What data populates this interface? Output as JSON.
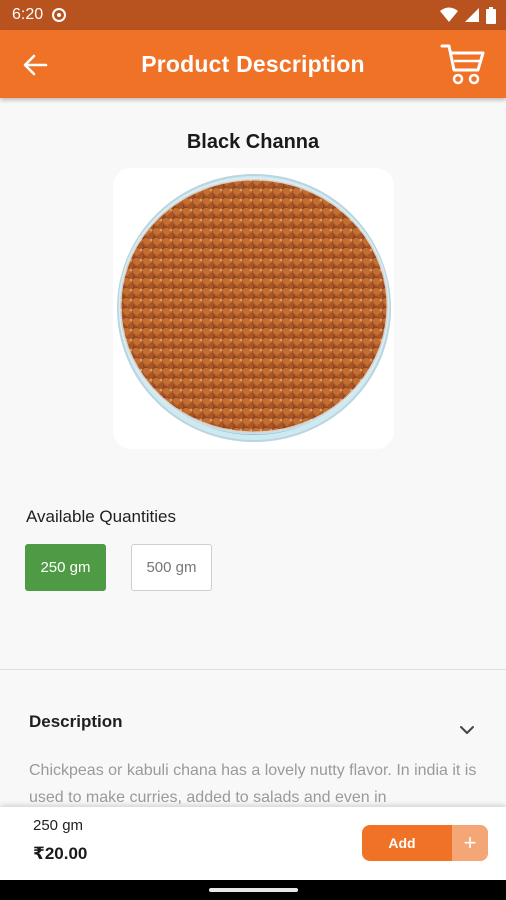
{
  "status_bar": {
    "time": "6:20"
  },
  "app_bar": {
    "title": "Product Description"
  },
  "product": {
    "name": "Black Channa"
  },
  "quantities": {
    "heading": "Available Quantities",
    "options": [
      {
        "label": "250 gm",
        "selected": true
      },
      {
        "label": "500 gm",
        "selected": false
      }
    ]
  },
  "description": {
    "heading": "Description",
    "text": "Chickpeas or kabuli chana has a lovely nutty flavor. In india it is used to make curries, added to salads and even in"
  },
  "bottom_bar": {
    "variant": "250 gm",
    "price": "₹20.00",
    "add_label": "Add",
    "plus_label": "+"
  },
  "colors": {
    "primary": "#f07226",
    "status_bar": "#b8531f",
    "selected_quantity": "#4e9a45",
    "add_plus": "#f4a677"
  },
  "icons": [
    "back-arrow-icon",
    "cart-icon",
    "wifi-icon",
    "signal-icon",
    "battery-icon",
    "chevron-down-icon"
  ]
}
